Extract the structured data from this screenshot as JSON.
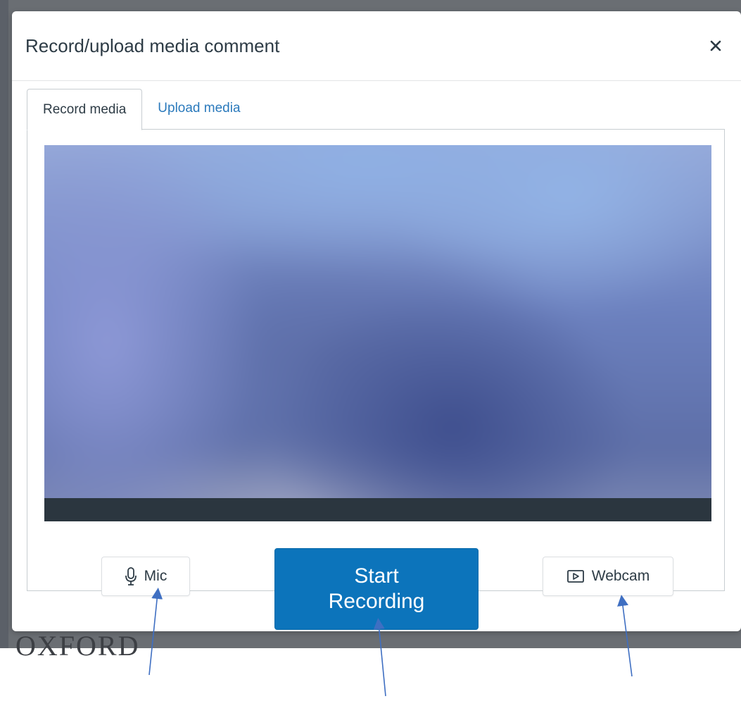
{
  "background": {
    "wordmark": "OXFORD"
  },
  "modal": {
    "title": "Record/upload media comment",
    "close_icon": "close-icon",
    "tabs": [
      {
        "label": "Record media",
        "active": true
      },
      {
        "label": "Upload media",
        "active": false
      }
    ],
    "controls": {
      "mic": {
        "label": "Mic",
        "icon": "microphone-icon"
      },
      "start_recording": {
        "line1": "Start",
        "line2": "Recording"
      },
      "webcam": {
        "label": "Webcam",
        "icon": "webcam-icon"
      }
    }
  },
  "colors": {
    "primary_button": "#0c74bb",
    "tab_link": "#2b7abc",
    "annotation_arrow": "#3f6fc2",
    "preview_bar": "#2b363f"
  }
}
